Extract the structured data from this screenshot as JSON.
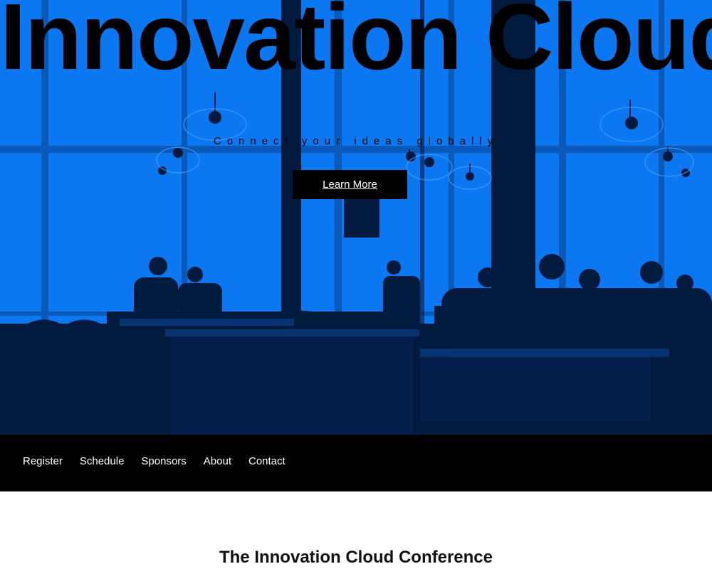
{
  "hero": {
    "title": "Innovation Cloud",
    "subtitle": "Connect your ideas globally",
    "cta_label": "Learn More",
    "background_color": "#0a75f0",
    "silhouette_color": "#021a3d"
  },
  "nav": {
    "items": [
      {
        "label": "Register"
      },
      {
        "label": "Schedule"
      },
      {
        "label": "Sponsors"
      },
      {
        "label": "About"
      },
      {
        "label": "Contact"
      }
    ]
  },
  "section": {
    "title": "The Innovation Cloud Conference"
  }
}
